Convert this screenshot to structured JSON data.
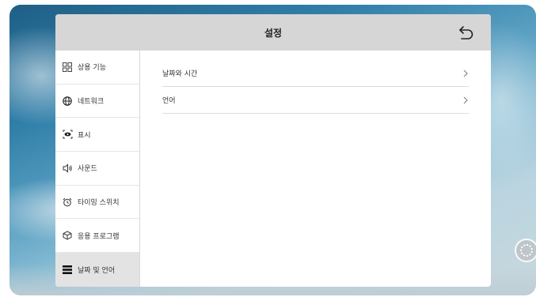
{
  "window": {
    "title": "설정"
  },
  "sidebar": {
    "items": [
      {
        "label": "상용 기능",
        "icon": "grid-icon",
        "active": false
      },
      {
        "label": "네트워크",
        "icon": "globe-icon",
        "active": false
      },
      {
        "label": "표시",
        "icon": "display-eye-icon",
        "active": false
      },
      {
        "label": "사운드",
        "icon": "speaker-icon",
        "active": false
      },
      {
        "label": "타이밍 스위치",
        "icon": "alarm-clock-icon",
        "active": false
      },
      {
        "label": "응용 프로그램",
        "icon": "cube-icon",
        "active": false
      },
      {
        "label": "날짜 및 언어",
        "icon": "list-icon",
        "active": true
      }
    ]
  },
  "content": {
    "rows": [
      {
        "label": "날짜와 시간"
      },
      {
        "label": "언어"
      }
    ]
  },
  "colors": {
    "titlebar": "#d6d6d6",
    "active_item": "#e3e3e3",
    "text": "#333333"
  }
}
